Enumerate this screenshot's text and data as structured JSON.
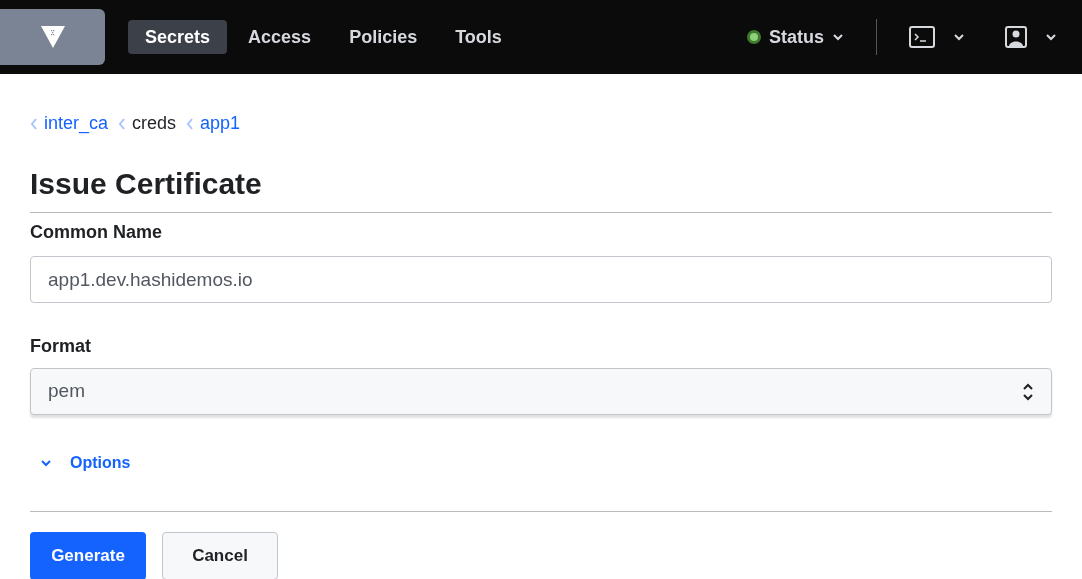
{
  "nav": {
    "items": [
      {
        "label": "Secrets",
        "selected": true
      },
      {
        "label": "Access",
        "selected": false
      },
      {
        "label": "Policies",
        "selected": false
      },
      {
        "label": "Tools",
        "selected": false
      }
    ],
    "status": "Status"
  },
  "breadcrumbs": [
    {
      "label": "inter_ca",
      "kind": "link"
    },
    {
      "label": "creds",
      "kind": "text"
    },
    {
      "label": "app1",
      "kind": "link"
    }
  ],
  "title": "Issue Certificate",
  "fields": [
    {
      "label": "Common Name",
      "kind": "input",
      "value": "app1.dev.hashidemos.io"
    },
    {
      "label": "Format",
      "kind": "select",
      "value": "pem"
    }
  ],
  "options": {
    "label": "Options",
    "expanded": false
  },
  "buttons": [
    {
      "label": "Generate",
      "kind": "primary"
    },
    {
      "label": "Cancel",
      "kind": "secondary"
    }
  ]
}
